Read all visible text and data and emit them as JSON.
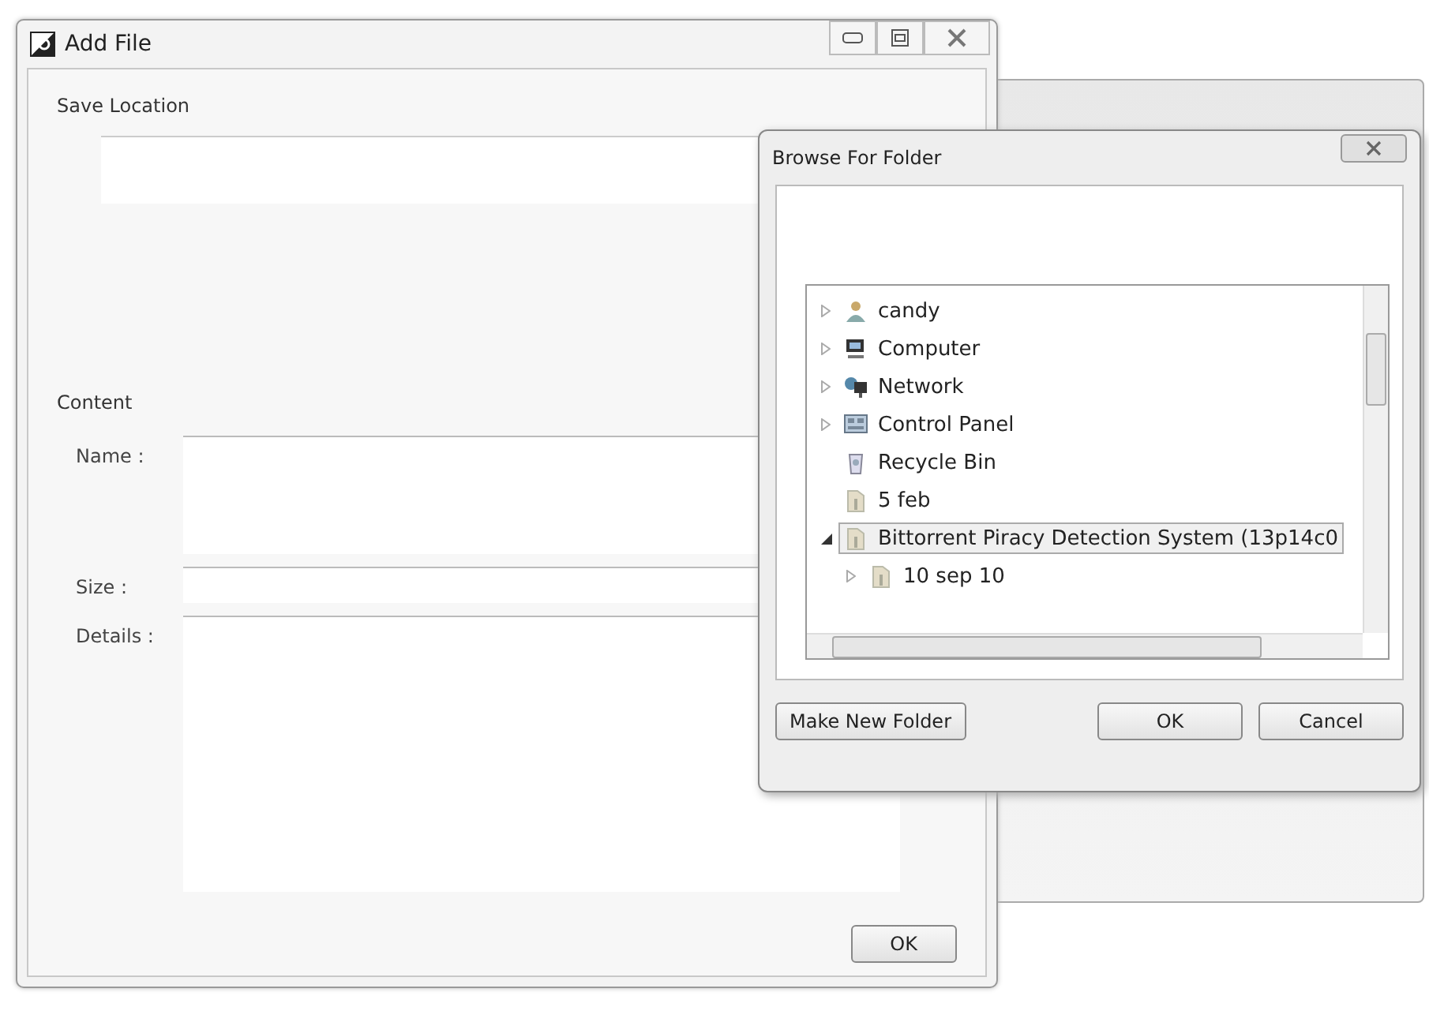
{
  "window": {
    "title": "Add File"
  },
  "save_location": {
    "label": "Save Location"
  },
  "content": {
    "label": "Content",
    "fields": [
      {
        "label": "Name :",
        "kind": "text"
      },
      {
        "label": "Size :",
        "kind": "line"
      },
      {
        "label": "Details :",
        "kind": "area"
      }
    ]
  },
  "buttons": [
    "OK"
  ],
  "dialog": {
    "title": "Browse For Folder",
    "tree": [
      {
        "label": "candy",
        "kind": "user",
        "expanded": false,
        "selected": false
      },
      {
        "label": "Computer",
        "kind": "computer",
        "expanded": false,
        "selected": false
      },
      {
        "label": "Network",
        "kind": "network",
        "expanded": false,
        "selected": false
      },
      {
        "label": "Control Panel",
        "kind": "panel",
        "expanded": false,
        "selected": false
      },
      {
        "label": "Recycle Bin",
        "kind": "bin",
        "selected": false
      },
      {
        "label": "5 feb",
        "kind": "folder",
        "selected": false
      },
      {
        "label": "Bittorrent Piracy Detection System (13p14c0",
        "kind": "folder",
        "expanded": true,
        "selected": true,
        "children": [
          {
            "label": "10 sep 10",
            "kind": "folder",
            "expanded": false,
            "selected": false
          }
        ]
      }
    ],
    "buttons": [
      {
        "label": "Make New Folder",
        "kind": "secondary"
      },
      {
        "label": "OK",
        "kind": "primary"
      },
      {
        "label": "Cancel",
        "kind": "secondary"
      }
    ]
  }
}
